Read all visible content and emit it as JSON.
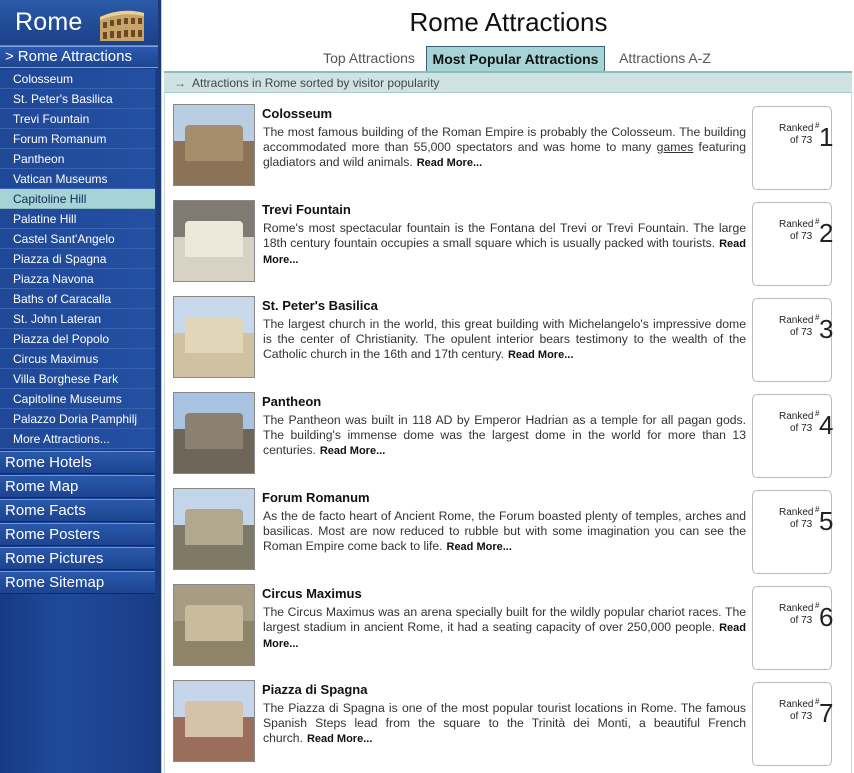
{
  "sidebar": {
    "site_title": "Rome",
    "current_section": "Rome Attractions",
    "current_section_arrow": ">",
    "sub_items": [
      "Colosseum",
      "St. Peter's Basilica",
      "Trevi Fountain",
      "Forum Romanum",
      "Pantheon",
      "Vatican Museums",
      "Capitoline Hill",
      "Palatine Hill",
      "Castel Sant'Angelo",
      "Piazza di Spagna",
      "Piazza Navona",
      "Baths of Caracalla",
      "St. John Lateran",
      "Piazza del Popolo",
      "Circus Maximus",
      "Villa Borghese Park",
      "Capitoline Museums",
      "Palazzo Doria Pamphilj",
      "More Attractions..."
    ],
    "active_sub_item": "Capitoline Hill",
    "main_links": [
      "Rome Hotels",
      "Rome Map",
      "Rome Facts",
      "Rome Posters",
      "Rome Pictures",
      "Rome Sitemap"
    ]
  },
  "main": {
    "page_title": "Rome Attractions",
    "tabs": [
      {
        "label": "Top Attractions",
        "active": false
      },
      {
        "label": "Most Popular Attractions",
        "active": true
      },
      {
        "label": "Attractions A-Z",
        "active": false
      }
    ],
    "subtitle_arrow": "→",
    "subtitle": "Attractions in Rome sorted by visitor popularity",
    "read_more": "Read More...",
    "ranked_label": "Ranked",
    "rank_hash": "#",
    "rank_of": "of 73",
    "attractions": [
      {
        "name": "Colosseum",
        "rank": "1",
        "desc_before": "The most famous building of the Roman Empire is probably the Colosseum. The building accommodated more than 55,000 spectators and was home to many ",
        "desc_link": "games",
        "desc_after": " featuring gladiators and wild animals.",
        "thumb": {
          "sky": "#b9cde3",
          "ground": "#8a7356",
          "shape": "#a48e6c"
        }
      },
      {
        "name": "Trevi Fountain",
        "rank": "2",
        "desc_before": "Rome's most spectacular fountain is the Fontana del Trevi or Trevi Fountain. The large 18th century fountain occupies a small square which is usually packed with tourists.",
        "desc_link": "",
        "desc_after": "",
        "thumb": {
          "sky": "#7f7a72",
          "ground": "#d8d2c4",
          "shape": "#eee8da"
        }
      },
      {
        "name": "St. Peter's Basilica",
        "rank": "3",
        "desc_before": "The largest church in the world, this great building with Michelangelo's impressive dome is the center of Christianity. The opulent interior bears testimony to the wealth of the Catholic church in the 16th and 17th century.",
        "desc_link": "",
        "desc_after": "",
        "thumb": {
          "sky": "#c7d8ea",
          "ground": "#cfc1a2",
          "shape": "#e2d6b8"
        }
      },
      {
        "name": "Pantheon",
        "rank": "4",
        "desc_before": "The Pantheon was built in 118 AD by Emperor Hadrian as a temple for all pagan gods. The building's immense dome was the largest dome in the world for more than 13 centuries.",
        "desc_link": "",
        "desc_after": "",
        "thumb": {
          "sky": "#a8c4e2",
          "ground": "#6e6658",
          "shape": "#8b8170"
        }
      },
      {
        "name": "Forum Romanum",
        "rank": "5",
        "desc_before": "As the de facto heart of Ancient Rome, the Forum boasted plenty of temples, arches and basilicas. Most are now reduced to rubble but with some imagination you can see the Roman Empire come back to life.",
        "desc_link": "",
        "desc_after": "",
        "thumb": {
          "sky": "#c3d5e8",
          "ground": "#7f7a66",
          "shape": "#b1a890"
        }
      },
      {
        "name": "Circus Maximus",
        "rank": "6",
        "desc_before": "The Circus Maximus was an arena specially built for the wildly popular chariot races. The largest stadium in ancient Rome, it had a seating capacity of over 250,000 people.",
        "desc_link": "",
        "desc_after": "",
        "thumb": {
          "sky": "#a89c84",
          "ground": "#8f8368",
          "shape": "#c9bc9c"
        }
      },
      {
        "name": "Piazza di Spagna",
        "rank": "7",
        "desc_before": "The Piazza di Spagna is one of the most popular tourist locations in Rome. The famous Spanish Steps lead from the square to the Trinità dei Monti, a beautiful French church.",
        "desc_link": "",
        "desc_after": "",
        "thumb": {
          "sky": "#c5d6ea",
          "ground": "#9a6e5a",
          "shape": "#d6c2a6"
        }
      }
    ]
  }
}
